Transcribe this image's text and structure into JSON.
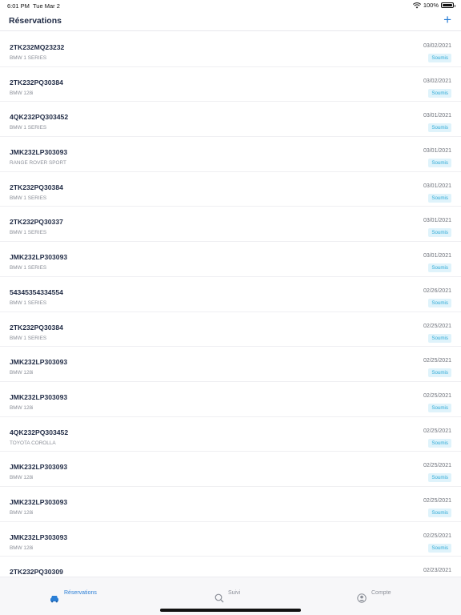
{
  "status": {
    "time": "6:01 PM",
    "date": "Tue Mar 2",
    "battery": "100%"
  },
  "nav": {
    "title": "Réservations",
    "add_label": "+"
  },
  "reservations": [
    {
      "code": "2TK232MQ23232",
      "model": "BMW 1 SERIES",
      "date": "03/02/2021",
      "status": "Soumis"
    },
    {
      "code": "2TK232PQ30384",
      "model": "BMW 128i",
      "date": "03/02/2021",
      "status": "Soumis"
    },
    {
      "code": "4QK232PQ303452",
      "model": "BMW 1 SERIES",
      "date": "03/01/2021",
      "status": "Soumis"
    },
    {
      "code": "JMK232LP303093",
      "model": "RANGE ROVER SPORT",
      "date": "03/01/2021",
      "status": "Soumis"
    },
    {
      "code": "2TK232PQ30384",
      "model": "BMW 1 SERIES",
      "date": "03/01/2021",
      "status": "Soumis"
    },
    {
      "code": "2TK232PQ30337",
      "model": "BMW 1 SERIES",
      "date": "03/01/2021",
      "status": "Soumis"
    },
    {
      "code": "JMK232LP303093",
      "model": "BMW 1 SERIES",
      "date": "03/01/2021",
      "status": "Soumis"
    },
    {
      "code": "54345354334554",
      "model": "BMW 1 SERIES",
      "date": "02/26/2021",
      "status": "Soumis"
    },
    {
      "code": "2TK232PQ30384",
      "model": "BMW 1 SERIES",
      "date": "02/25/2021",
      "status": "Soumis"
    },
    {
      "code": "JMK232LP303093",
      "model": "BMW 128i",
      "date": "02/25/2021",
      "status": "Soumis"
    },
    {
      "code": "JMK232LP303093",
      "model": "BMW 128i",
      "date": "02/25/2021",
      "status": "Soumis"
    },
    {
      "code": "4QK232PQ303452",
      "model": "TOYOTA COROLLA",
      "date": "02/25/2021",
      "status": "Soumis"
    },
    {
      "code": "JMK232LP303093",
      "model": "BMW 128i",
      "date": "02/25/2021",
      "status": "Soumis"
    },
    {
      "code": "JMK232LP303093",
      "model": "BMW 128i",
      "date": "02/25/2021",
      "status": "Soumis"
    },
    {
      "code": "JMK232LP303093",
      "model": "BMW 128i",
      "date": "02/25/2021",
      "status": "Soumis"
    },
    {
      "code": "2TK232PQ30309",
      "model": "",
      "date": "02/23/2021",
      "status": ""
    }
  ],
  "tabs": [
    {
      "label": "Réservations",
      "icon": "car-icon",
      "active": true
    },
    {
      "label": "Suivi",
      "icon": "search-icon",
      "active": false
    },
    {
      "label": "Compte",
      "icon": "account-icon",
      "active": false
    }
  ],
  "colors": {
    "accent": "#2b7fd6",
    "badge_text": "#2ea9d6",
    "badge_bg": "#dff3fb"
  }
}
